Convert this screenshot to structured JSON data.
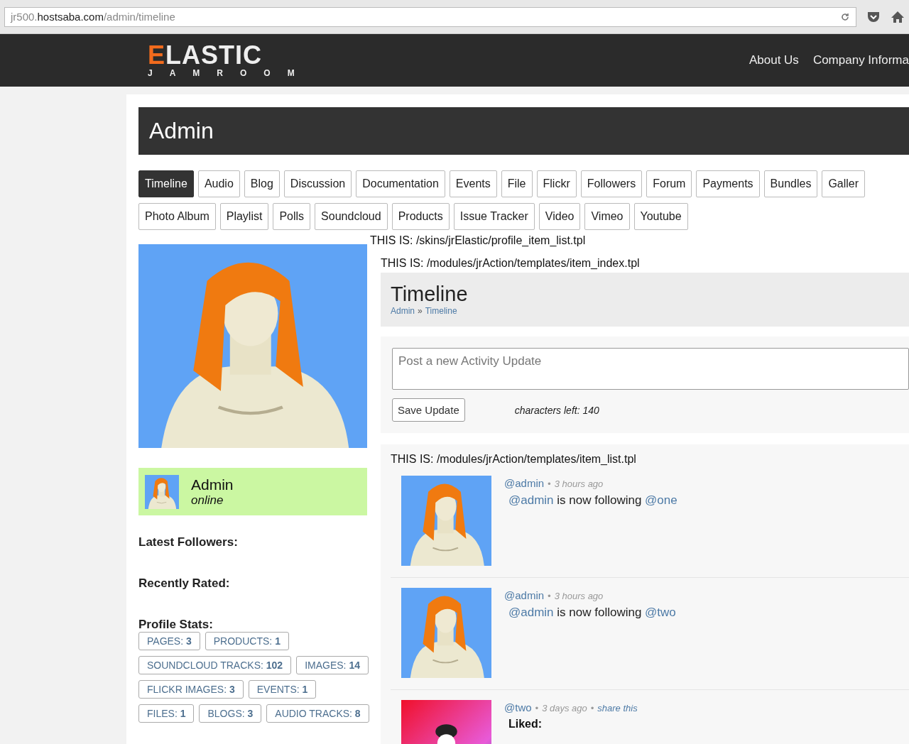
{
  "browser": {
    "url_prefix": "jr500.",
    "url_domain": "hostsaba.com",
    "url_path": "/admin/timeline"
  },
  "site": {
    "logo": "ELASTIC",
    "logo_sub": "JAMROOM",
    "nav": [
      "About Us",
      "Company Informa"
    ]
  },
  "profile": {
    "title": "Admin"
  },
  "tabs": [
    [
      {
        "label": "Timeline",
        "selected": true
      },
      {
        "label": "Audio",
        "selected": false
      },
      {
        "label": "Blog",
        "selected": false
      },
      {
        "label": "Discussion",
        "selected": false
      },
      {
        "label": "Documentation",
        "selected": false
      },
      {
        "label": "Events",
        "selected": false
      },
      {
        "label": "File",
        "selected": false
      },
      {
        "label": "Flickr",
        "selected": false
      },
      {
        "label": "Followers",
        "selected": false
      },
      {
        "label": "Forum",
        "selected": false
      },
      {
        "label": "Payments",
        "selected": false
      },
      {
        "label": "Bundles",
        "selected": false
      },
      {
        "label": "Galler",
        "selected": false
      }
    ],
    [
      {
        "label": "Photo Album",
        "selected": false
      },
      {
        "label": "Playlist",
        "selected": false
      },
      {
        "label": "Polls",
        "selected": false
      },
      {
        "label": "Soundcloud",
        "selected": false
      },
      {
        "label": "Products",
        "selected": false
      },
      {
        "label": "Issue Tracker",
        "selected": false
      },
      {
        "label": "Video",
        "selected": false
      },
      {
        "label": "Vimeo",
        "selected": false
      },
      {
        "label": "Youtube",
        "selected": false
      }
    ]
  ],
  "sidebar": {
    "user": {
      "name": "Admin",
      "status": "online"
    },
    "sections": [
      "Latest Followers:",
      "Recently Rated:",
      "Profile Stats:"
    ],
    "stats": [
      "PAGES: **3**",
      "PRODUCTS: **1**",
      "SOUNDCLOUD TRACKS: **102**",
      "IMAGES: **14**",
      "FLICKR IMAGES: **3**",
      "EVENTS: **1**",
      "FILES: **1**",
      "BLOGS: **3**",
      "AUDIO TRACKS: **8**"
    ]
  },
  "skin_template": "THIS IS: /skins/jrElastic/profile_item_list.tpl",
  "index_template": "THIS IS: /modules/jrAction/templates/item_index.tpl",
  "timeline": {
    "title": "Timeline",
    "breadcrumb": [
      "Admin",
      "Timeline"
    ],
    "breadcrumb_separator": "»"
  },
  "composer": {
    "placeholder": "Post a new Activity Update",
    "button": "Save Update",
    "chars_left": "characters left: 140"
  },
  "activity": {
    "template": "THIS IS: /modules/jrAction/templates/item_list.tpl",
    "separator": "•",
    "items": [
      {
        "kind": "follow",
        "handle": "@admin",
        "time": "3 hours ago",
        "actor": "@admin",
        "verb": "is now following",
        "target": "@one"
      },
      {
        "kind": "follow",
        "handle": "@admin",
        "time": "3 hours ago",
        "actor": "@admin",
        "verb": "is now following",
        "target": "@two"
      },
      {
        "kind": "like",
        "handle": "@two",
        "time": "3 days ago",
        "share": "share this",
        "liked": "Liked:"
      }
    ]
  }
}
